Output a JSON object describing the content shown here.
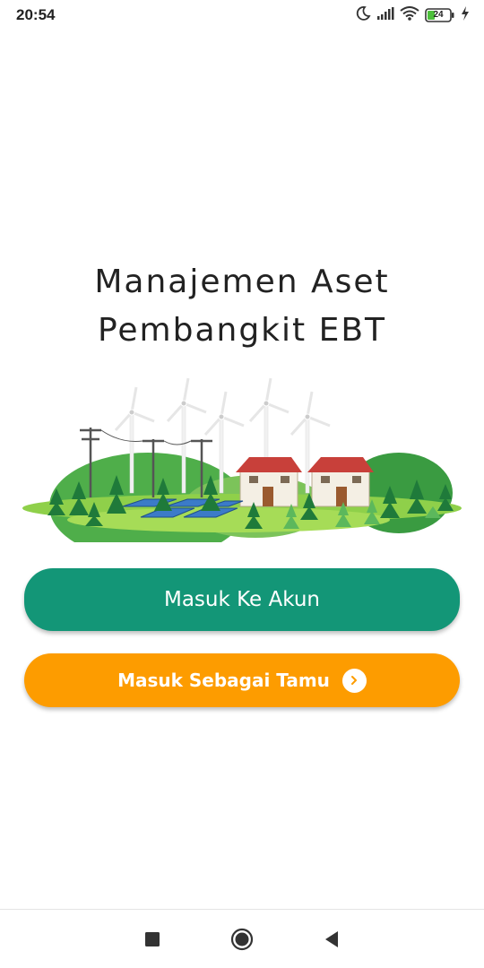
{
  "status_bar": {
    "time": "20:54",
    "battery_level": "24",
    "icons": [
      "moon-icon",
      "signal-icon",
      "wifi-icon",
      "battery-icon",
      "charging-icon"
    ]
  },
  "page": {
    "title_line1": "Manajemen Aset",
    "title_line2": "Pembangkit EBT"
  },
  "buttons": {
    "login_label": "Masuk Ke Akun",
    "guest_label": "Masuk Sebagai Tamu"
  },
  "colors": {
    "login_button": "#139677",
    "guest_button": "#fd9c00"
  },
  "nav_bar": {
    "icons": [
      "recent-apps-icon",
      "home-icon",
      "back-icon"
    ]
  }
}
